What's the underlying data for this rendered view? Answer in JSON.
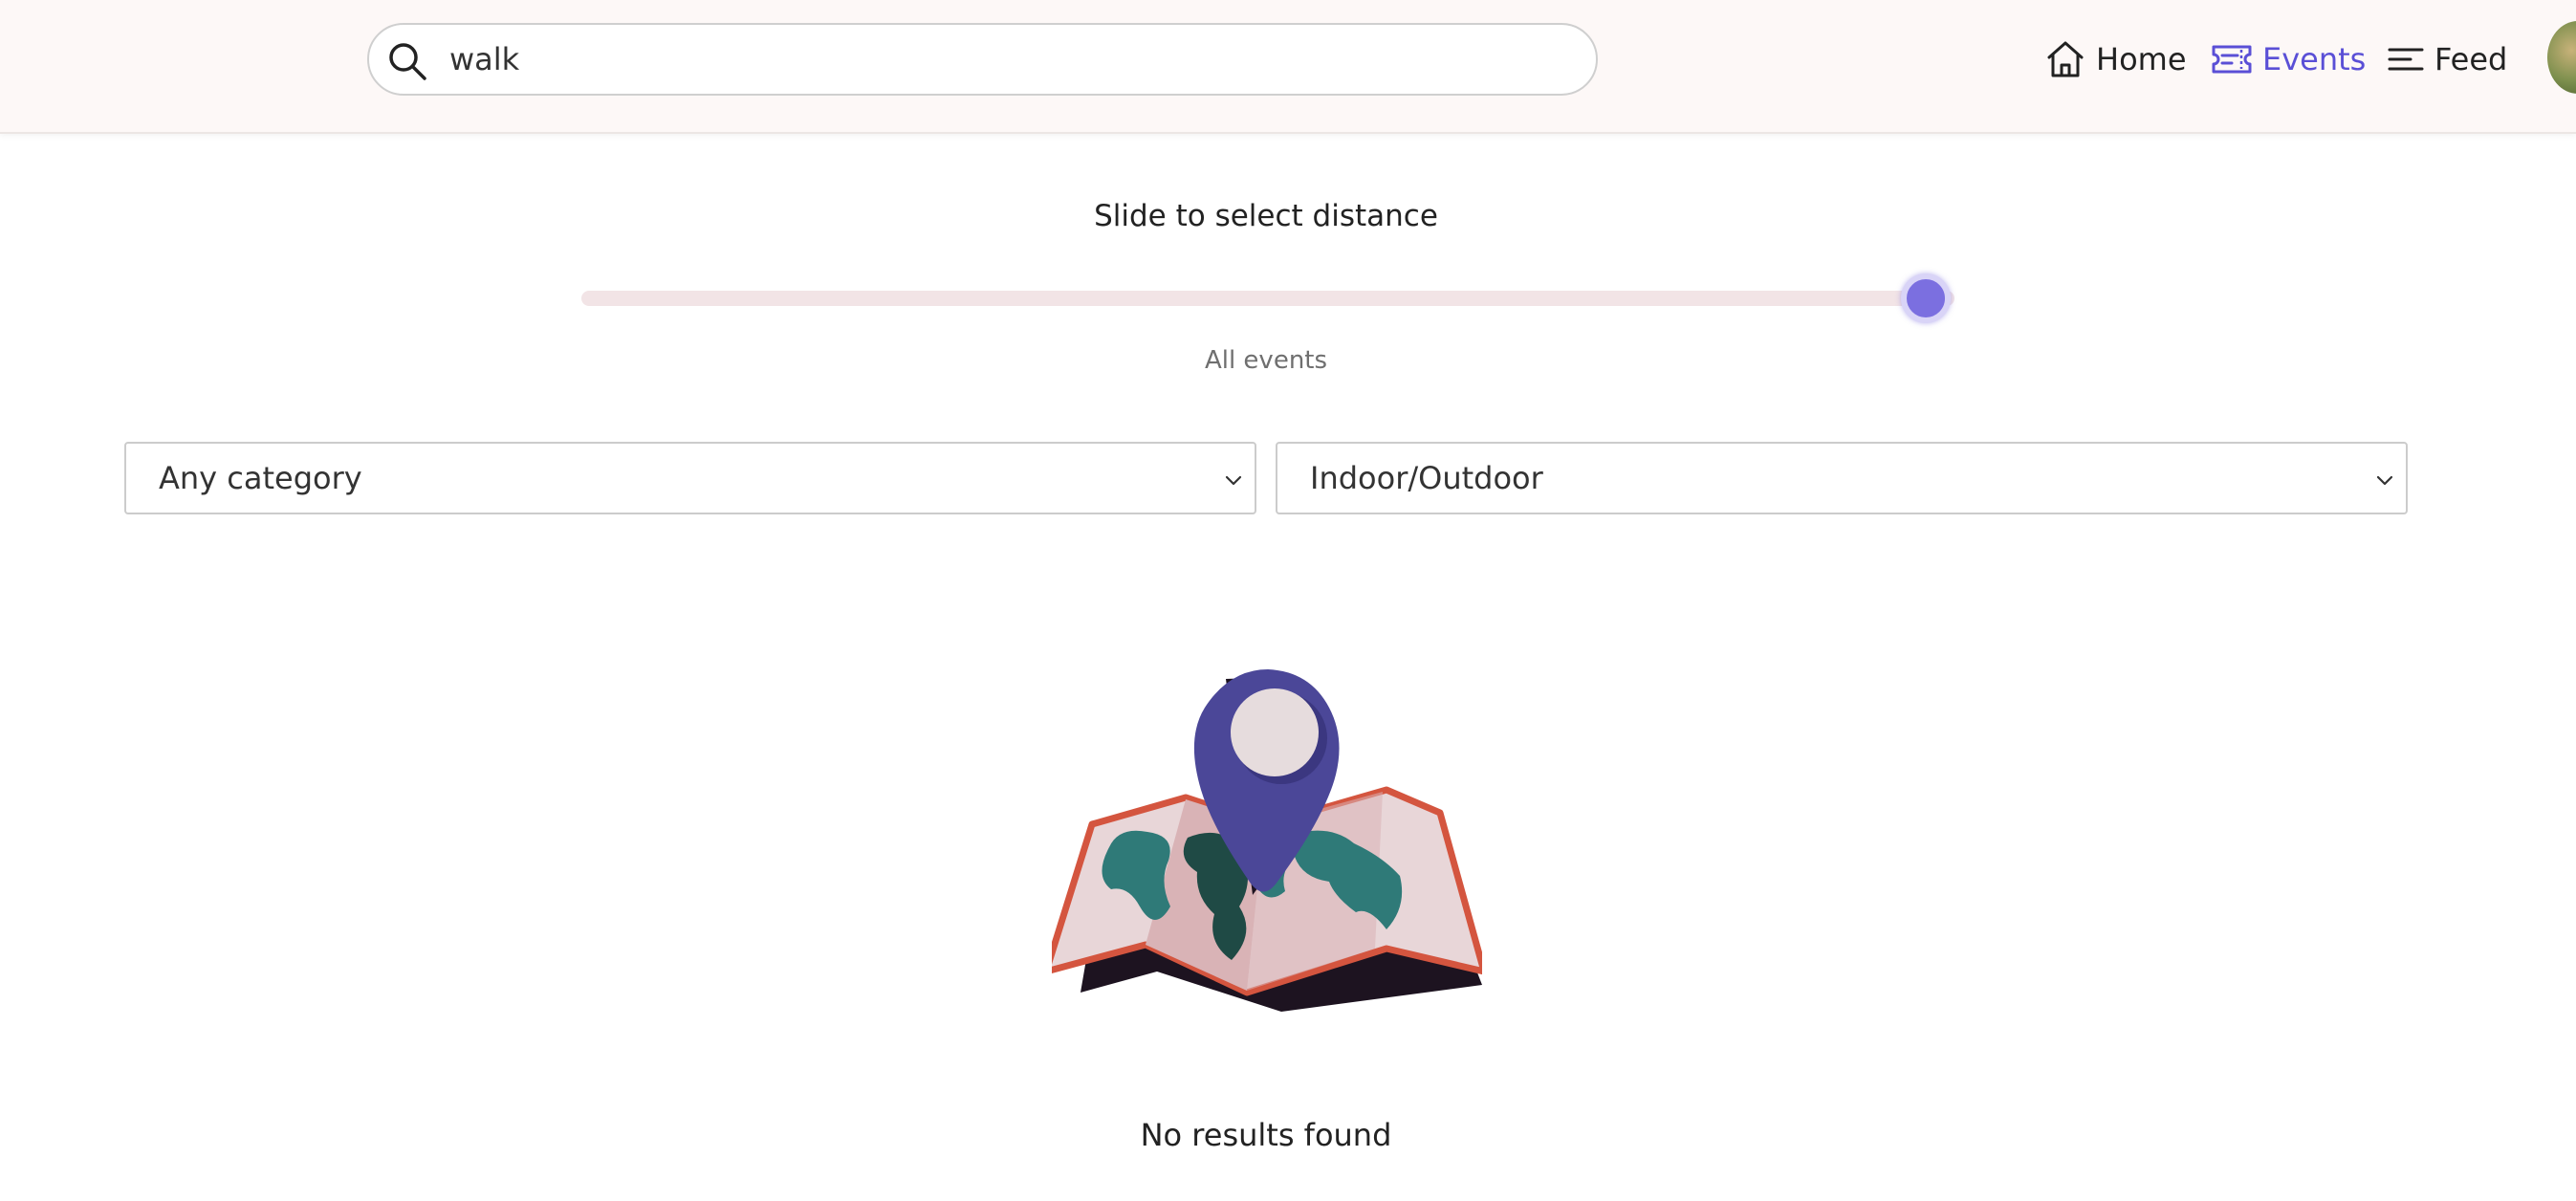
{
  "header": {
    "search": {
      "value": "walk",
      "icon": "search-icon"
    },
    "nav": [
      {
        "label": "Home",
        "icon": "home-icon",
        "active": false
      },
      {
        "label": "Events",
        "icon": "ticket-icon",
        "active": true
      },
      {
        "label": "Feed",
        "icon": "feed-lines-icon",
        "active": false
      }
    ],
    "avatar": "user-avatar"
  },
  "distance": {
    "title": "Slide to select distance",
    "caption": "All events",
    "position_fraction": 1.0,
    "accent_color": "#7b6fe0"
  },
  "filters": {
    "category": {
      "selected": "Any category"
    },
    "location": {
      "selected": "Indoor/Outdoor"
    }
  },
  "empty_state": {
    "illustration": "map-with-location-pin",
    "message": "No results found"
  },
  "colors": {
    "header_bg": "#fdf8f7",
    "active_nav": "#5a4fd6",
    "pin": "#4b4798",
    "map_border": "#d4553f",
    "map_land": "#2f7a78"
  }
}
